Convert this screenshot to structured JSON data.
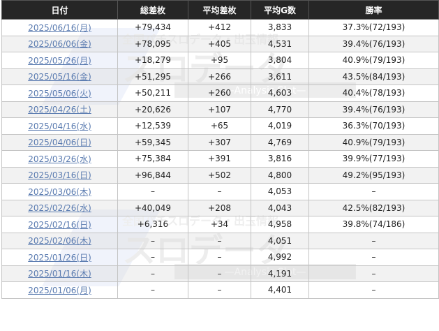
{
  "headers": [
    "日付",
    "総差枚",
    "平均差枚",
    "平均G数",
    "勝率"
  ],
  "watermark": {
    "line1": "全国パチスロデータ・出玉情報",
    "line2": "スロデータ",
    "line3": "—Analysis Slot—"
  },
  "rows": [
    {
      "date": "2025/06/16(月)",
      "total": "+79,434",
      "avg_diff": "+412",
      "avg_games": "3,833",
      "win_rate": "37.3%(72/193)"
    },
    {
      "date": "2025/06/06(金)",
      "total": "+78,095",
      "avg_diff": "+405",
      "avg_games": "4,531",
      "win_rate": "39.4%(76/193)"
    },
    {
      "date": "2025/05/26(月)",
      "total": "+18,279",
      "avg_diff": "+95",
      "avg_games": "3,804",
      "win_rate": "40.9%(79/193)"
    },
    {
      "date": "2025/05/16(金)",
      "total": "+51,295",
      "avg_diff": "+266",
      "avg_games": "3,611",
      "win_rate": "43.5%(84/193)"
    },
    {
      "date": "2025/05/06(火)",
      "total": "+50,211",
      "avg_diff": "+260",
      "avg_games": "4,603",
      "win_rate": "40.4%(78/193)"
    },
    {
      "date": "2025/04/26(土)",
      "total": "+20,626",
      "avg_diff": "+107",
      "avg_games": "4,770",
      "win_rate": "39.4%(76/193)"
    },
    {
      "date": "2025/04/16(水)",
      "total": "+12,539",
      "avg_diff": "+65",
      "avg_games": "4,019",
      "win_rate": "36.3%(70/193)"
    },
    {
      "date": "2025/04/06(日)",
      "total": "+59,345",
      "avg_diff": "+307",
      "avg_games": "4,769",
      "win_rate": "40.9%(79/193)"
    },
    {
      "date": "2025/03/26(水)",
      "total": "+75,384",
      "avg_diff": "+391",
      "avg_games": "3,816",
      "win_rate": "39.9%(77/193)"
    },
    {
      "date": "2025/03/16(日)",
      "total": "+96,844",
      "avg_diff": "+502",
      "avg_games": "4,800",
      "win_rate": "49.2%(95/193)"
    },
    {
      "date": "2025/03/06(木)",
      "total": "–",
      "avg_diff": "–",
      "avg_games": "4,053",
      "win_rate": "–"
    },
    {
      "date": "2025/02/26(水)",
      "total": "+40,049",
      "avg_diff": "+208",
      "avg_games": "4,043",
      "win_rate": "42.5%(82/193)"
    },
    {
      "date": "2025/02/16(日)",
      "total": "+6,316",
      "avg_diff": "+34",
      "avg_games": "4,958",
      "win_rate": "39.8%(74/186)"
    },
    {
      "date": "2025/02/06(木)",
      "total": "–",
      "avg_diff": "–",
      "avg_games": "4,051",
      "win_rate": "–"
    },
    {
      "date": "2025/01/26(日)",
      "total": "–",
      "avg_diff": "–",
      "avg_games": "4,992",
      "win_rate": "–"
    },
    {
      "date": "2025/01/16(木)",
      "total": "–",
      "avg_diff": "–",
      "avg_games": "4,191",
      "win_rate": "–"
    },
    {
      "date": "2025/01/06(月)",
      "total": "–",
      "avg_diff": "–",
      "avg_games": "4,401",
      "win_rate": "–"
    }
  ]
}
